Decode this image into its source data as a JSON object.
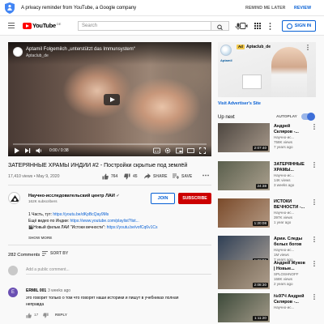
{
  "privacy": {
    "message": "A privacy reminder from YouTube, a Google company",
    "remind_later": "REMIND ME LATER",
    "review": "REVIEW"
  },
  "masthead": {
    "logo_text": "YouTube",
    "country_code": "DE",
    "search_placeholder": "Search",
    "sign_in": "SIGN IN"
  },
  "player": {
    "overlay_title": "Aptamil Folgemilch „unterstützt das Immunsystem“",
    "overlay_channel": "Aptaclub_de",
    "time": "0:00 / 0:38"
  },
  "video": {
    "title": "ЗАТЕРЯННЫЕ ХРАМЫ ИНДИИ #2 - Постройки скрытые под землёй",
    "meta": "17,410 views • May 9, 2020",
    "likes": "764",
    "dislikes": "45",
    "share": "SHARE",
    "save": "SAVE"
  },
  "channel": {
    "name": "Научно-исследовательский центр ЛАИ",
    "subs": "162K subscribers",
    "join": "JOIN",
    "subscribe": "SUBSCRIBE"
  },
  "description": {
    "line1_text": "1 Часть, тут: ",
    "line1_link": "https://youtu.be/dKpBcQay9Ms",
    "line2_text": "Ещё видео по Индии: ",
    "line2_link": "https://www.youtube.com/playlist?list...",
    "line3_text": "🎬Новый фильм ЛАИ \"Истоки вечности\": ",
    "line3_link": "https://youtu.be/vofCq6v1Cs",
    "show_more": "SHOW MORE"
  },
  "comments": {
    "count": "282 Comments",
    "sort_by": "SORT BY",
    "add_placeholder": "Add a public comment...",
    "items": [
      {
        "avatar_letter": "E",
        "author": "ERMIL 001",
        "time": "3 weeks ago",
        "text_line1": "это говорит только о том что говорят наши историки и пишут в учебниках полная",
        "text_line2": "неправда",
        "likes": "17",
        "reply": "REPLY"
      }
    ]
  },
  "ad": {
    "tag": "Ad",
    "name": "Aptaclub_de",
    "visit": "Visit Advertiser's Site",
    "brand": "Aptamil"
  },
  "sidebar": {
    "up_next": "Up next",
    "autoplay": "AUTOPLAY",
    "videos": [
      {
        "title_l1": "Андрей",
        "title_l2": "Скляров -...",
        "channel": "Научно-ис...",
        "views": "758K views",
        "age": "7 years ago",
        "duration": "2:07:40",
        "tint": "#4d4640"
      },
      {
        "title_l1": "ЗАТЕРЯННЫЕ",
        "title_l2": "ХРАМЫ...",
        "channel": "Научно-ис...",
        "views": "14K views",
        "age": "3 weeks ago",
        "duration": "24:38",
        "tint": "#5a5f4d"
      },
      {
        "title_l1": "ИСТОКИ",
        "title_l2": "ВЕЧНОСТИ -...",
        "channel": "Научно-ис...",
        "views": "397K views",
        "age": "1 year ago",
        "duration": "1:20:08",
        "tint": "#7a4a2a"
      },
      {
        "title_l1": "Арии. Следы",
        "title_l2": "белых богов",
        "channel": "Научно-ис...",
        "views": "1M views",
        "age": "7 years ago",
        "duration": "1:32:06",
        "tint": "#2f3f55"
      },
      {
        "title_l1": "Андрей Жуков",
        "title_l2": "| Новые...",
        "channel": "SPLOSHNOFF",
        "views": "168K views",
        "age": "2 years ago",
        "duration": "2:08:30",
        "tint": "#6b5d4c"
      },
      {
        "title_l1": "№97Ч Андрей",
        "title_l2": "Скляров -...",
        "channel": "Научно-ис...",
        "views": "",
        "age": "",
        "duration": "1:11:20",
        "tint": "#3d4a3a"
      }
    ]
  },
  "colors": {
    "accent": "#065fd4",
    "subscribe": "#cc0000",
    "youtube_red": "#ff0000"
  }
}
